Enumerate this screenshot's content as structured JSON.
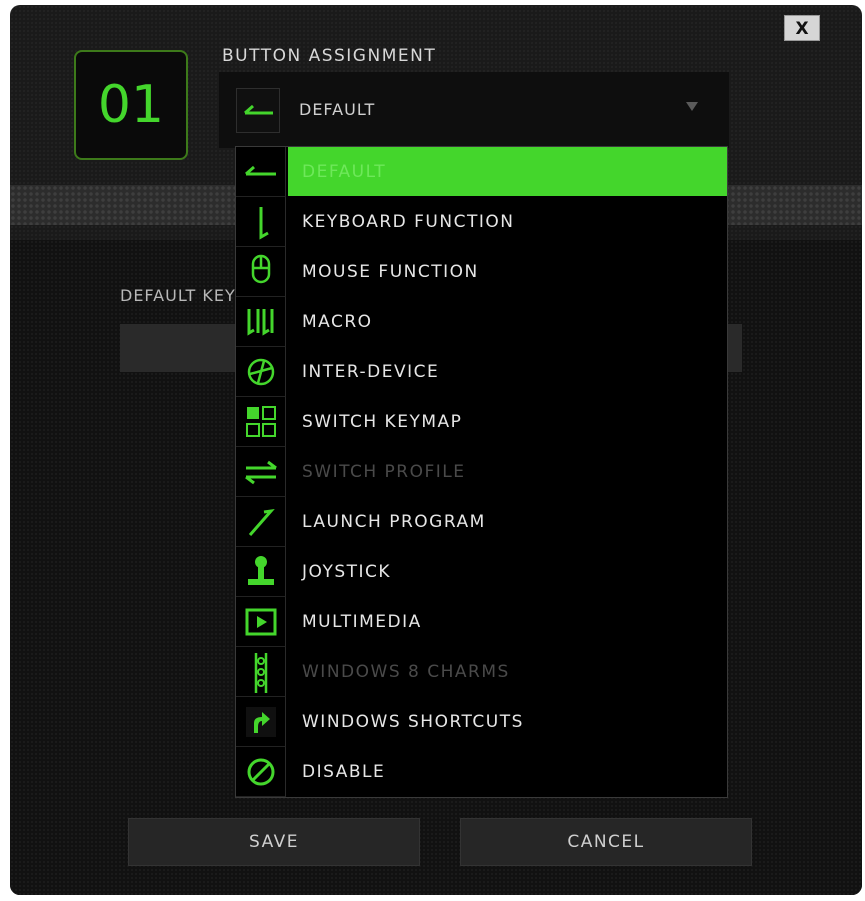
{
  "window": {
    "close_label": "X"
  },
  "header": {
    "button_number": "01",
    "assignment_label": "BUTTON ASSIGNMENT",
    "selected_value": "DEFAULT"
  },
  "body": {
    "default_key_label": "DEFAULT KEY"
  },
  "dropdown": {
    "items": [
      {
        "label": "DEFAULT",
        "icon": "arrow-left-icon",
        "state": "selected"
      },
      {
        "label": "KEYBOARD FUNCTION",
        "icon": "keyboard-function-icon",
        "state": "enabled"
      },
      {
        "label": "MOUSE FUNCTION",
        "icon": "mouse-icon",
        "state": "enabled"
      },
      {
        "label": "MACRO",
        "icon": "macro-icon",
        "state": "enabled"
      },
      {
        "label": "INTER-DEVICE",
        "icon": "inter-device-icon",
        "state": "enabled"
      },
      {
        "label": "SWITCH KEYMAP",
        "icon": "switch-keymap-icon",
        "state": "enabled"
      },
      {
        "label": "SWITCH PROFILE",
        "icon": "switch-profile-icon",
        "state": "disabled"
      },
      {
        "label": "LAUNCH PROGRAM",
        "icon": "launch-program-icon",
        "state": "enabled"
      },
      {
        "label": "JOYSTICK",
        "icon": "joystick-icon",
        "state": "enabled"
      },
      {
        "label": "MULTIMEDIA",
        "icon": "multimedia-icon",
        "state": "enabled"
      },
      {
        "label": "WINDOWS 8 CHARMS",
        "icon": "windows-charms-icon",
        "state": "disabled"
      },
      {
        "label": "WINDOWS SHORTCUTS",
        "icon": "windows-shortcuts-icon",
        "state": "enabled"
      },
      {
        "label": "DISABLE",
        "icon": "disable-icon",
        "state": "enabled"
      }
    ]
  },
  "footer": {
    "save_label": "SAVE",
    "cancel_label": "CANCEL"
  },
  "colors": {
    "accent": "#44d62c",
    "background": "#1a1a1a",
    "text": "#e6e6e6",
    "disabled_text": "#4a4a4a"
  }
}
